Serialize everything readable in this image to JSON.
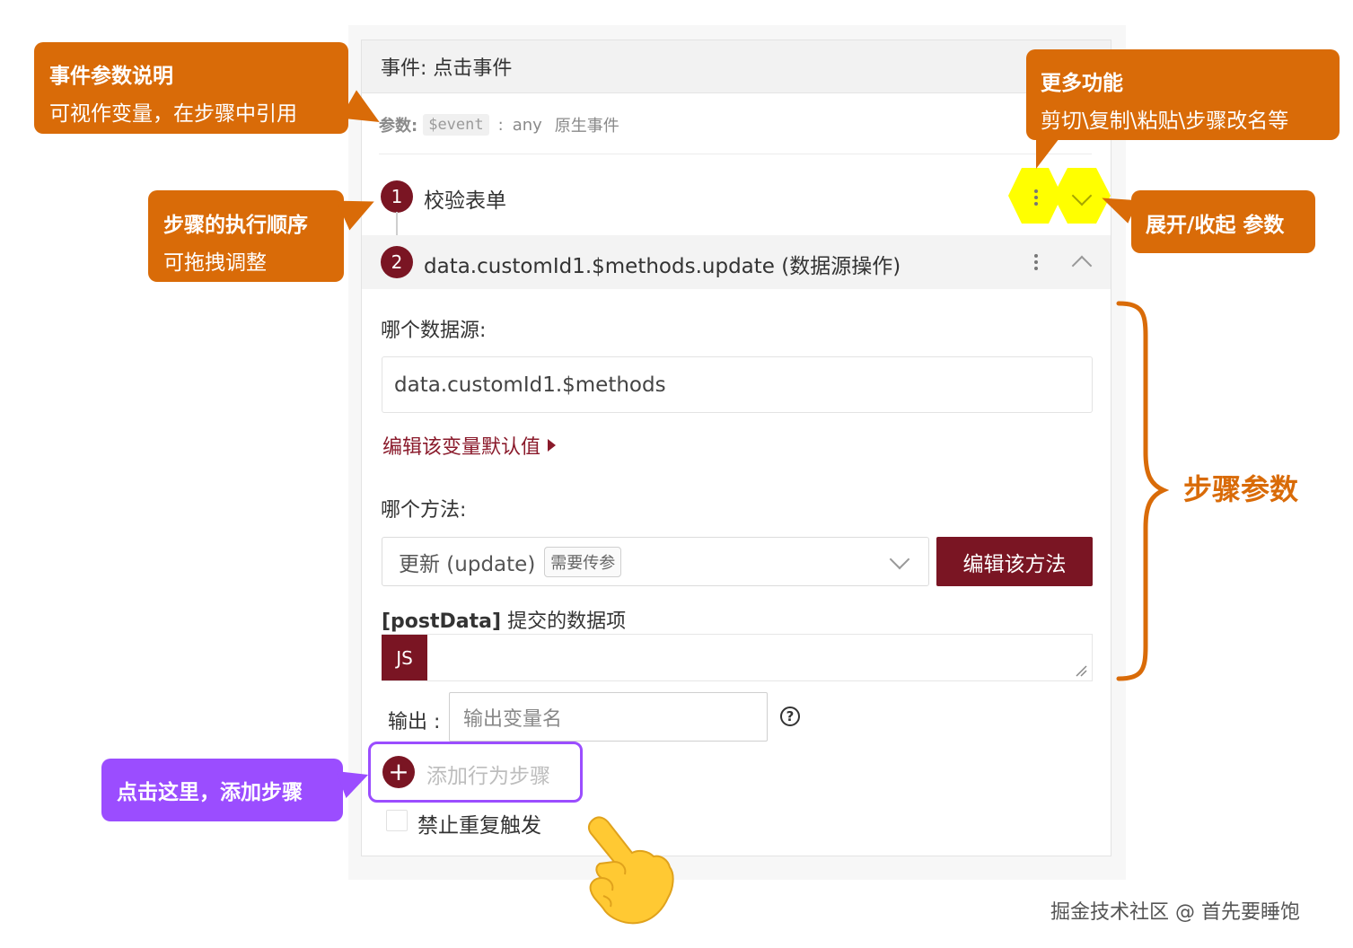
{
  "event": {
    "title": "事件: 点击事件",
    "params_label": "参数:",
    "param_name": "$event",
    "param_sep": ":",
    "param_type": "any",
    "param_desc": "原生事件"
  },
  "steps": [
    {
      "number": "1",
      "label": "校验表单",
      "expanded": false
    },
    {
      "number": "2",
      "label": "data.customId1.$methods.update (数据源操作)",
      "expanded": true
    }
  ],
  "step_params": {
    "datasource_label": "哪个数据源:",
    "datasource_value": "data.customId1.$methods",
    "edit_default_link": "编辑该变量默认值",
    "method_label": "哪个方法:",
    "method_value": "更新 (update)",
    "method_tag": "需要传参",
    "edit_method_button": "编辑该方法",
    "postdata_key": "[postData]",
    "postdata_desc": "提交的数据项",
    "js_button": "JS",
    "output_label": "输出 :",
    "output_placeholder": "输出变量名",
    "help_glyph": "?"
  },
  "add_step": {
    "plus": "+",
    "label": "添加行为步骤"
  },
  "no_repeat_label": "禁止重复触发",
  "annotations": {
    "event_params": {
      "title": "事件参数说明",
      "desc": "可视作变量，在步骤中引用"
    },
    "more_functions": {
      "title": "更多功能",
      "desc": "剪切\\复制\\粘贴\\步骤改名等"
    },
    "step_order": {
      "title": "步骤的执行顺序",
      "desc": "可拖拽调整"
    },
    "expand_collapse": {
      "title": "展开/收起 参数"
    },
    "step_params": {
      "title": "步骤参数"
    },
    "add_step_hint": {
      "title": "点击这里，添加步骤"
    }
  },
  "watermark": "掘金技术社区 @ 首先要睡饱",
  "colors": {
    "brand": "#7a1523",
    "annotation_orange": "#d96b08",
    "annotation_purple": "#9b4dff",
    "highlight": "#ffff00"
  },
  "icons": {
    "more": "more-vertical-icon",
    "expand": "chevron-down-icon",
    "collapse": "chevron-up-icon",
    "help": "help-circle-icon",
    "pointer": "pointing-hand-icon"
  }
}
